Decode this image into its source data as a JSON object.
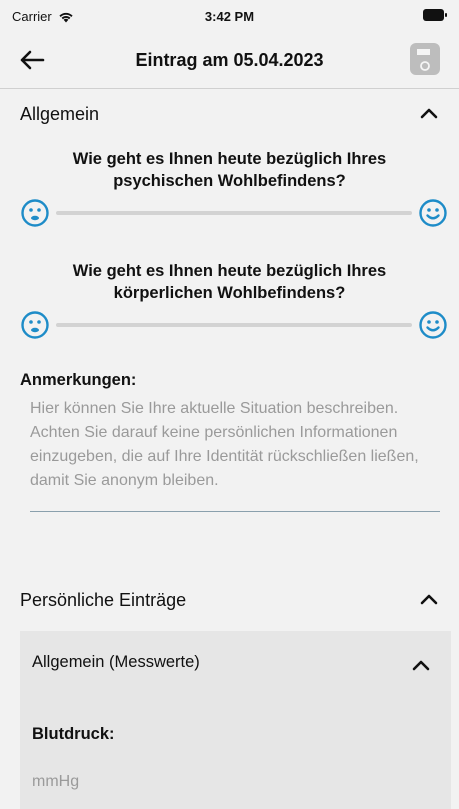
{
  "status_bar": {
    "carrier": "Carrier",
    "time": "3:42 PM",
    "icons": [
      "wifi-icon",
      "battery-icon"
    ]
  },
  "nav": {
    "back_icon": "arrow-left-icon",
    "title": "Eintrag am 05.04.2023",
    "save_icon": "floppy-disk-icon"
  },
  "general": {
    "label": "Allgemein",
    "chevron_icon": "chevron-up-icon",
    "question_psychic": "Wie geht es Ihnen heute bezüglich Ihres psychischen Wohlbefindens?",
    "question_physical": "Wie geht es Ihnen heute bezüglich Ihres körperlichen Wohlbefindens?",
    "slider_icons": [
      "sad-face-icon",
      "happy-face-icon"
    ],
    "notes_label": "Anmerkungen:",
    "notes_placeholder": "Hier können Sie Ihre aktuelle Situation beschreiben. Achten Sie darauf keine persönlichen Informationen einzugeben, die auf Ihre Identität rückschließen ließen, damit Sie anonym bleiben."
  },
  "personal": {
    "label": "Persönliche Einträge",
    "sub_section": {
      "label": "Allgemein (Messwerte)",
      "blood_pressure_label": "Blutdruck:",
      "blood_pressure_placeholder": "mmHg"
    }
  },
  "colors": {
    "background": "#f2f2f2",
    "accent": "#1e8cc8",
    "sub_panel": "#e6e6e6",
    "save_disabled": "#bdbdbd",
    "placeholder": "#9a9a9a"
  }
}
